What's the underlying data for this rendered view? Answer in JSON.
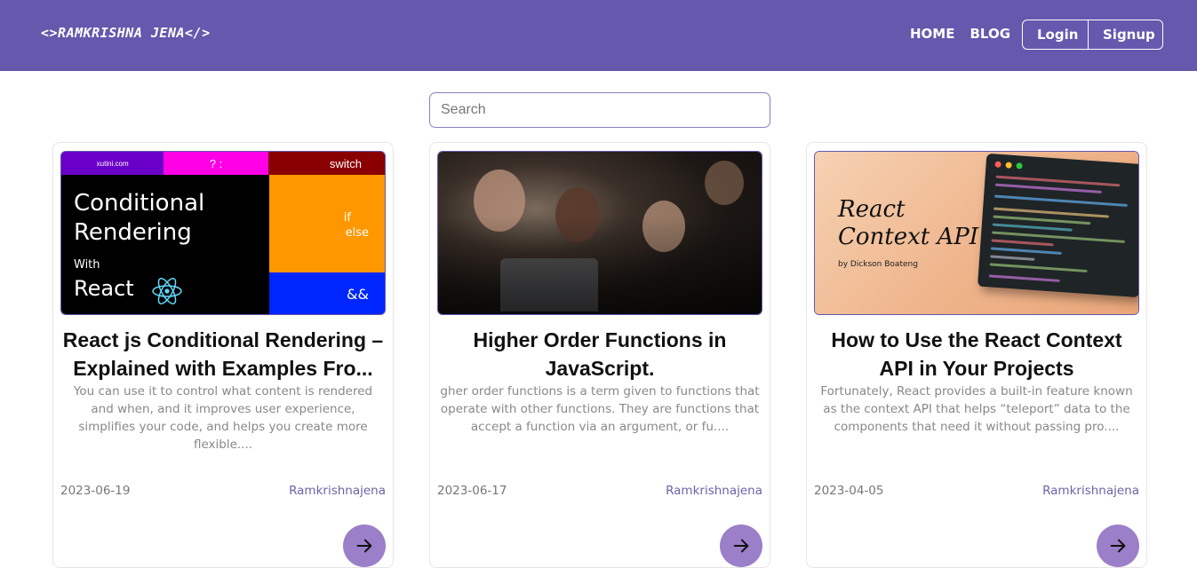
{
  "navbar": {
    "brand": "<>RAMKRISHNA JENA</>",
    "links": [
      "HOME",
      "BLOG"
    ],
    "login": "Login",
    "signup": "Signup"
  },
  "search": {
    "placeholder": "Search",
    "value": ""
  },
  "cards": [
    {
      "title": "React js Conditional Rendering – Explained with Examples Fro...",
      "excerpt": "You can use it to control what content is rendered and when, and it improves user experience, simplifies your code, and helps you create more flexible....",
      "date": "2023-06-19",
      "author": "Ramkrishnajena",
      "image": {
        "site": "xutini.com",
        "ternary": "? :",
        "switch": "switch",
        "heading_line1": "Conditional",
        "heading_line2": "Rendering",
        "with": "With",
        "react": "React",
        "if": "if",
        "else": "else",
        "and": "&&"
      }
    },
    {
      "title": "Higher Order Functions in JavaScript.",
      "excerpt": "gher order functions is a term given to functions that operate with other functions. They are functions that accept a function via an argument, or fu....",
      "date": "2023-06-17",
      "author": "Ramkrishnajena"
    },
    {
      "title": "How to Use the React Context API in Your Projects",
      "excerpt": "Fortunately, React provides a built-in feature known as the context API that helps “teleport” data to the components that need it without passing pro....",
      "date": "2023-04-05",
      "author": "Ramkrishnajena",
      "image": {
        "title_line1": "React",
        "title_line2": "Context API",
        "byline": "by Dickson Boateng"
      }
    }
  ],
  "colors": {
    "navbar": "#6558ad",
    "accent_button": "#9b7fc9"
  },
  "icons": {
    "card_action": "arrow-right-icon"
  }
}
